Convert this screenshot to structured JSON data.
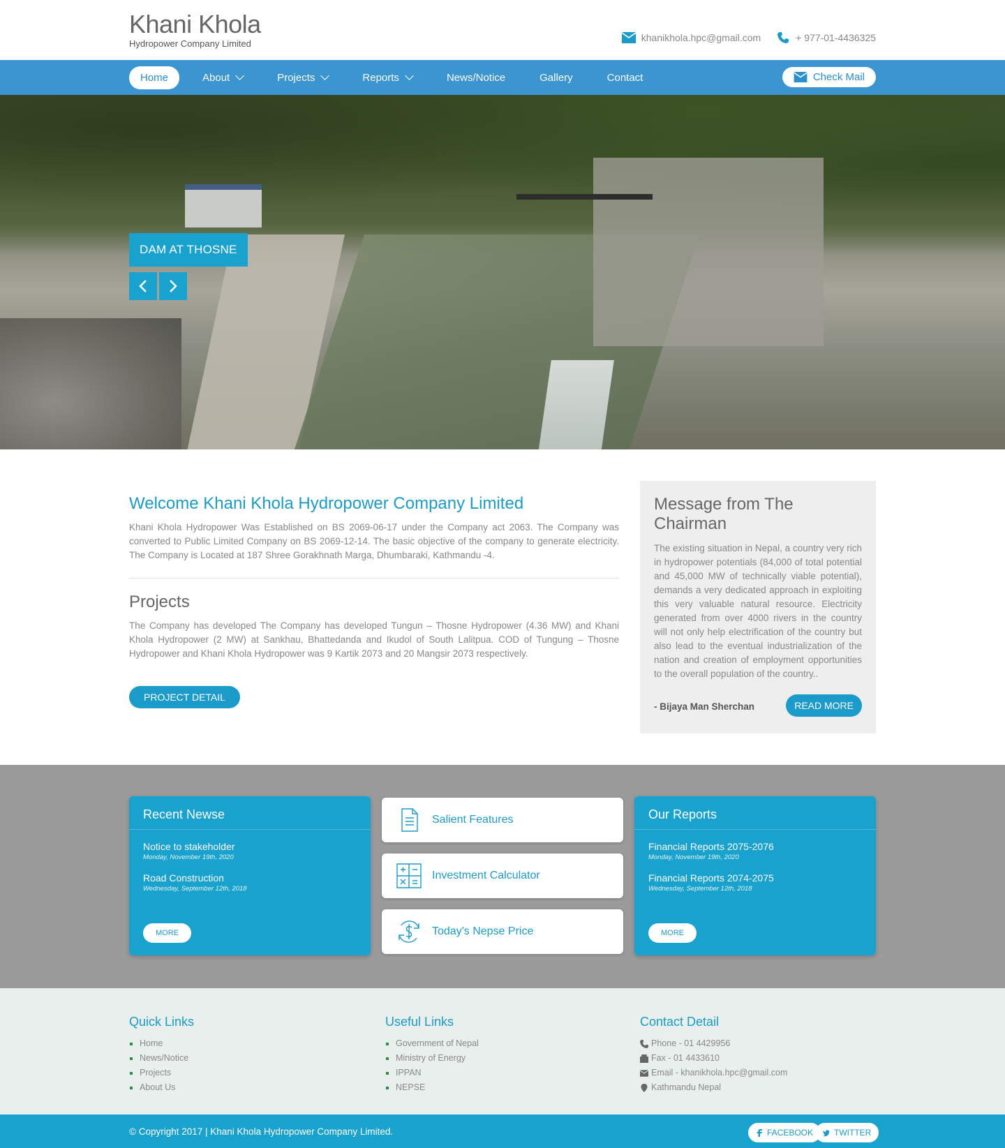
{
  "header": {
    "logo_title": "Khani Khola",
    "logo_subtitle": "Hydropower Company Limited",
    "email": "khanikhola.hpc@gmail.com",
    "phone": "+ 977-01-4436325"
  },
  "nav": {
    "items": [
      {
        "label": "Home",
        "active": true
      },
      {
        "label": "About",
        "dropdown": true
      },
      {
        "label": "Projects",
        "dropdown": true
      },
      {
        "label": "Reports",
        "dropdown": true
      },
      {
        "label": "News/Notice"
      },
      {
        "label": "Gallery"
      },
      {
        "label": "Contact"
      }
    ],
    "check_mail": "Check Mail"
  },
  "hero": {
    "caption": "DAM AT THOSNE"
  },
  "welcome": {
    "title": "Welcome Khani Khola Hydropower Company Limited",
    "text": "Khani Khola Hydropower Was Established on BS 2069-06-17 under the Company act 2063. The Company was converted to Public Limited Company on BS 2069-12-14. The basic objective of the company to generate electricity. The Company is Located at 187 Shree Gorakhnath Marga, Dhumbaraki, Kathmandu -4."
  },
  "projects": {
    "title": "Projects",
    "text": "The Company has developed The Company has developed Tungun – Thosne Hydropower (4.36 MW) and Khani Khola Hydropower (2 MW) at Sankhau, Bhattedanda and Ikudol of South Lalitpua. COD of Tungung – Thosne Hydropower and Khani Khola Hydropower was 9 Kartik 2073 and 20 Mangsir 2073 respectively.",
    "button": "PROJECT DETAIL"
  },
  "chairman": {
    "title": "Message from The Chairman",
    "text": "The existing situation in Nepal, a country very rich in hydropower potentials (84,000 of total potential and 45,000 MW of technically viable potential), demands a very dedicated approach in exploiting this very valuable natural resource. Electricity generated from over 4000 rivers in the country will not only help electrification of the country but also lead to the eventual industrialization of the nation and creation of employment opportunities to the overall population of the country..",
    "signature": "- Bijaya Man Sherchan",
    "button": "READ MORE"
  },
  "news": {
    "title": "Recent Newse",
    "items": [
      {
        "title": "Notice to stakeholder",
        "date": "Monday, November 19th, 2020"
      },
      {
        "title": "Road Construction",
        "date": "Wednesday, September 12th, 2018"
      }
    ],
    "more": "MORE"
  },
  "tiles": [
    {
      "label": "Salient Features",
      "icon": "document-icon"
    },
    {
      "label": "Investment Calculator",
      "icon": "calculator-icon"
    },
    {
      "label": "Today's Nepse Price",
      "icon": "dollar-cycle-icon"
    }
  ],
  "reports": {
    "title": "Our Reports",
    "items": [
      {
        "title": "Financial Reports 2075-2076",
        "date": "Monday, November 19th, 2020"
      },
      {
        "title": "Financial Reports 2074-2075",
        "date": "Wednesday, September 12th, 2018"
      }
    ],
    "more": "MORE"
  },
  "footer": {
    "quick_links": {
      "title": "Quick Links",
      "items": [
        "Home",
        "News/Notice",
        "Projects",
        "About Us"
      ]
    },
    "useful_links": {
      "title": "Useful Links",
      "items": [
        "Government of Nepal",
        "Ministry of Energy",
        "IPPAN",
        "NEPSE"
      ]
    },
    "contact": {
      "title": "Contact Detail",
      "phone": "Phone - 01 4429956",
      "fax": "Fax - 01 4433610",
      "email": "Email - khanikhola.hpc@gmail.com",
      "address": "Kathmandu Nepal"
    }
  },
  "bottom": {
    "copyright": "© Copyright 2017 | Khani Khola Hydropower Company Limited.",
    "facebook": "FACEBOOK",
    "twitter": "TWITTER"
  },
  "colors": {
    "accent": "#1aa2cf",
    "nav": "#3a95d0",
    "band": "#9a9a9a",
    "footer": "#e9efec"
  }
}
